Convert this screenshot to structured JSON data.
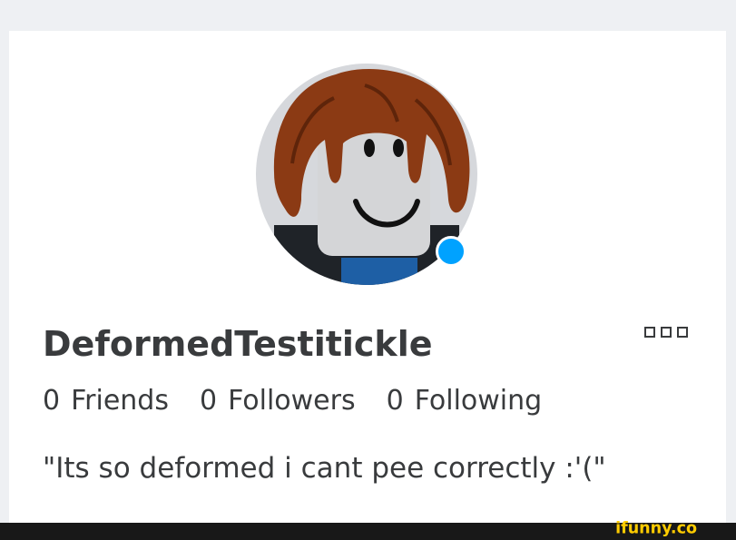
{
  "profile": {
    "username": "DeformedTestitickle",
    "blurb": "\"Its so deformed i cant pee correctly :'(\""
  },
  "stats": [
    {
      "count": "0",
      "label": "Friends"
    },
    {
      "count": "0",
      "label": "Followers"
    },
    {
      "count": "0",
      "label": "Following"
    }
  ],
  "icons": {
    "avatar": "avatar-image",
    "presence": "online-status-dot",
    "more": "more-options-icon"
  },
  "colors": {
    "presence_dot": "#00a2ff",
    "text": "#393b3d",
    "card": "#ffffff",
    "page_bg": "#eef0f3",
    "hair": "#8b3a14",
    "head": "#d4d5d7",
    "torso": "#1f2328",
    "shirt_blue": "#1e5fa5"
  },
  "watermark": {
    "text": "ifunny.co"
  }
}
